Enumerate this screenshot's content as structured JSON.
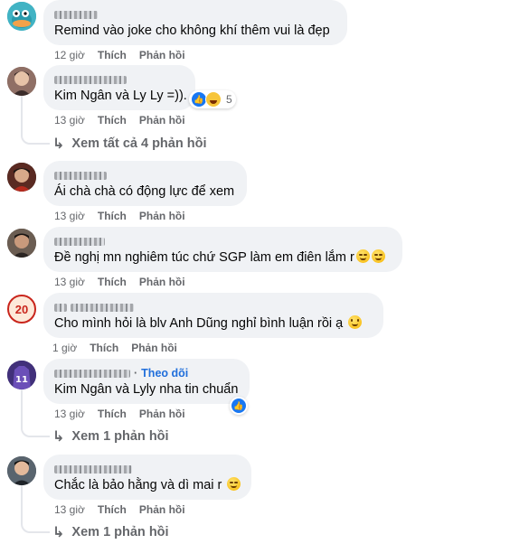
{
  "comments": [
    {
      "text": "Remind vào joke cho không khí thêm vui là đẹp",
      "time": "12 giờ",
      "like": "Thích",
      "reply": "Phản hồi"
    },
    {
      "text": "Kim Ngân và Ly Ly =)).",
      "time": "13 giờ",
      "like": "Thích",
      "reply": "Phản hồi",
      "reaction_count": "5",
      "view_replies": "Xem tất cả 4 phản hồi"
    },
    {
      "text": "Ái chà chà có động lực để xem",
      "time": "13 giờ",
      "like": "Thích",
      "reply": "Phản hồi"
    },
    {
      "text": "Đề nghị mn nghiêm túc chứ SGP làm em điên lắm r",
      "time": "13 giờ",
      "like": "Thích",
      "reply": "Phản hồi"
    },
    {
      "avatar_text": "20",
      "text": "Cho mình hỏi là blv Anh Dũng nghỉ bình luận rồi ạ",
      "time": "1 giờ",
      "like": "Thích",
      "reply": "Phản hồi"
    },
    {
      "follow": "Theo dõi",
      "text": "Kim Ngân và Lyly nha tin chuẩn",
      "time": "13 giờ",
      "like": "Thích",
      "reply": "Phản hồi",
      "view_replies": "Xem 1 phản hồi"
    },
    {
      "text": "Chắc là bảo hằng và dì mai r",
      "time": "13 giờ",
      "like": "Thích",
      "reply": "Phản hồi",
      "view_replies": "Xem 1 phản hồi"
    }
  ],
  "icons": {
    "reply_arrow": "reply-arrow-icon",
    "like": "like-reaction-icon",
    "haha": "haha-reaction-icon"
  },
  "colors": {
    "bubble": "#f0f2f5",
    "meta": "#65676b",
    "follow": "#216fdb",
    "like_blue": "#1877f2"
  }
}
